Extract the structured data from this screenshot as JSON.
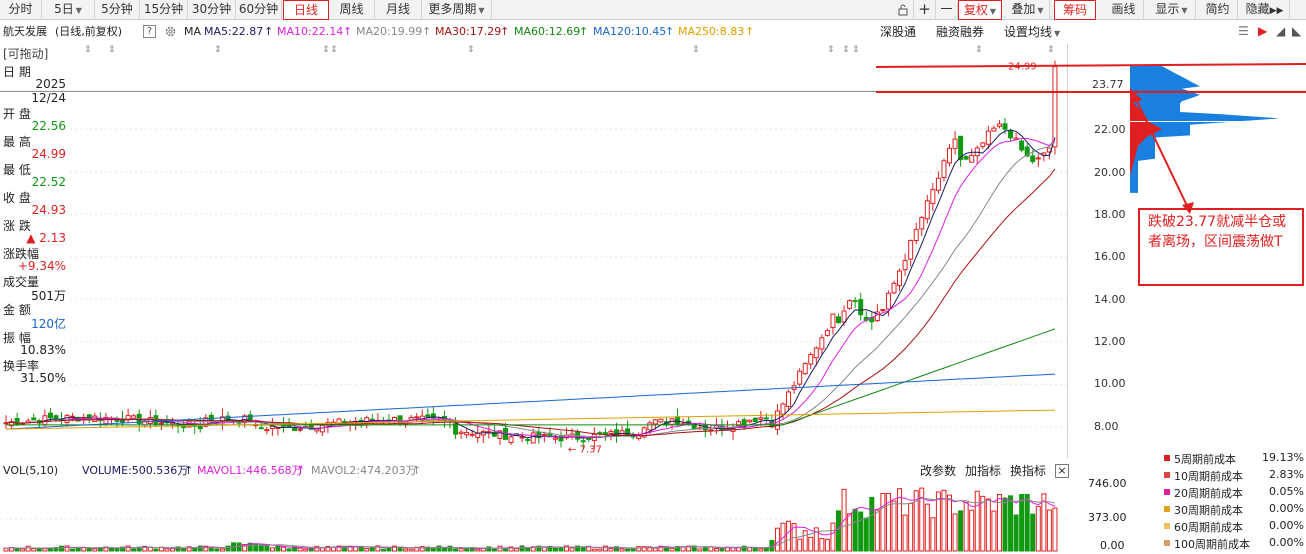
{
  "toolbar": {
    "periods": [
      "分时",
      "5日",
      "5分钟",
      "15分钟",
      "30分钟",
      "60分钟",
      "日线",
      "周线",
      "月线",
      "更多周期"
    ],
    "active_period": "日线",
    "right_buttons": [
      "复权",
      "叠加",
      "筹码",
      "画线",
      "显示",
      "简约",
      "隐藏"
    ],
    "plus": "+",
    "minus": "一"
  },
  "stock": {
    "name": "航天发展",
    "mode": "(日线,前复权)",
    "drag_label": "[可拖动]"
  },
  "ma": {
    "label": "MA",
    "items": [
      {
        "text": "MA5:22.87",
        "color": "#1a1a66"
      },
      {
        "text": "MA10:22.14",
        "color": "#e020e0"
      },
      {
        "text": "MA20:19.99",
        "color": "#888888"
      },
      {
        "text": "MA30:17.29",
        "color": "#aa1111"
      },
      {
        "text": "MA60:12.69",
        "color": "#118811"
      },
      {
        "text": "MA120:10.45",
        "color": "#1a66cc"
      },
      {
        "text": "MA250:8.83",
        "color": "#e0a000"
      }
    ]
  },
  "links": [
    "深股通",
    "融资融券",
    "设置均线"
  ],
  "info_panel": {
    "rows": [
      {
        "label": "日 期",
        "value": "2025",
        "color": "#222222"
      },
      {
        "label": "",
        "value": "12/24",
        "color": "#222222"
      },
      {
        "label": "开 盘",
        "value": "22.56",
        "color": "#119911"
      },
      {
        "label": "最 高",
        "value": "24.99",
        "color": "#e02020"
      },
      {
        "label": "最 低",
        "value": "22.52",
        "color": "#119911"
      },
      {
        "label": "收 盘",
        "value": "24.93",
        "color": "#e02020"
      },
      {
        "label": "涨 跌",
        "value": "▲ 2.13",
        "color": "#e02020"
      },
      {
        "label": "涨跌幅",
        "value": "+9.34%",
        "color": "#e02020"
      },
      {
        "label": "成交量",
        "value": "501万",
        "color": "#222222"
      },
      {
        "label": "金 额",
        "value": "120亿",
        "color": "#1a66cc"
      },
      {
        "label": "振 幅",
        "value": "10.83%",
        "color": "#222222"
      },
      {
        "label": "换手率",
        "value": "31.50%",
        "color": "#222222"
      }
    ]
  },
  "chart_data": {
    "type": "candlestick",
    "y_ticks": [
      "22.00",
      "20.00",
      "18.00",
      "16.00",
      "14.00",
      "12.00",
      "10.00",
      "8.00"
    ],
    "current_price_label": "23.77",
    "high_label": "24.99",
    "low_label": "7.37",
    "volume_ticks": [
      "746.00",
      "373.00",
      "0.00"
    ]
  },
  "annotation": {
    "text": "跌破23.77就减半仓或者离场，区间震荡做T"
  },
  "volume": {
    "label": "VOL(5,10)",
    "volume": "VOLUME:500.536万",
    "mavol1": "MAVOL1:446.568万",
    "mavol2": "MAVOL2:474.203万",
    "buttons": [
      "改参数",
      "加指标",
      "换指标"
    ]
  },
  "chip_stats": [
    {
      "name": "5周期前成本",
      "pct": "19.13%",
      "color": "#e02020"
    },
    {
      "name": "10周期前成本",
      "pct": "2.83%",
      "color": "#e04040"
    },
    {
      "name": "20周期前成本",
      "pct": "0.05%",
      "color": "#e020a0"
    },
    {
      "name": "30周期前成本",
      "pct": "0.00%",
      "color": "#e0a020"
    },
    {
      "name": "60周期前成本",
      "pct": "0.00%",
      "color": "#f0c060"
    },
    {
      "name": "100周期前成本",
      "pct": "0.00%",
      "color": "#d0a060"
    }
  ]
}
